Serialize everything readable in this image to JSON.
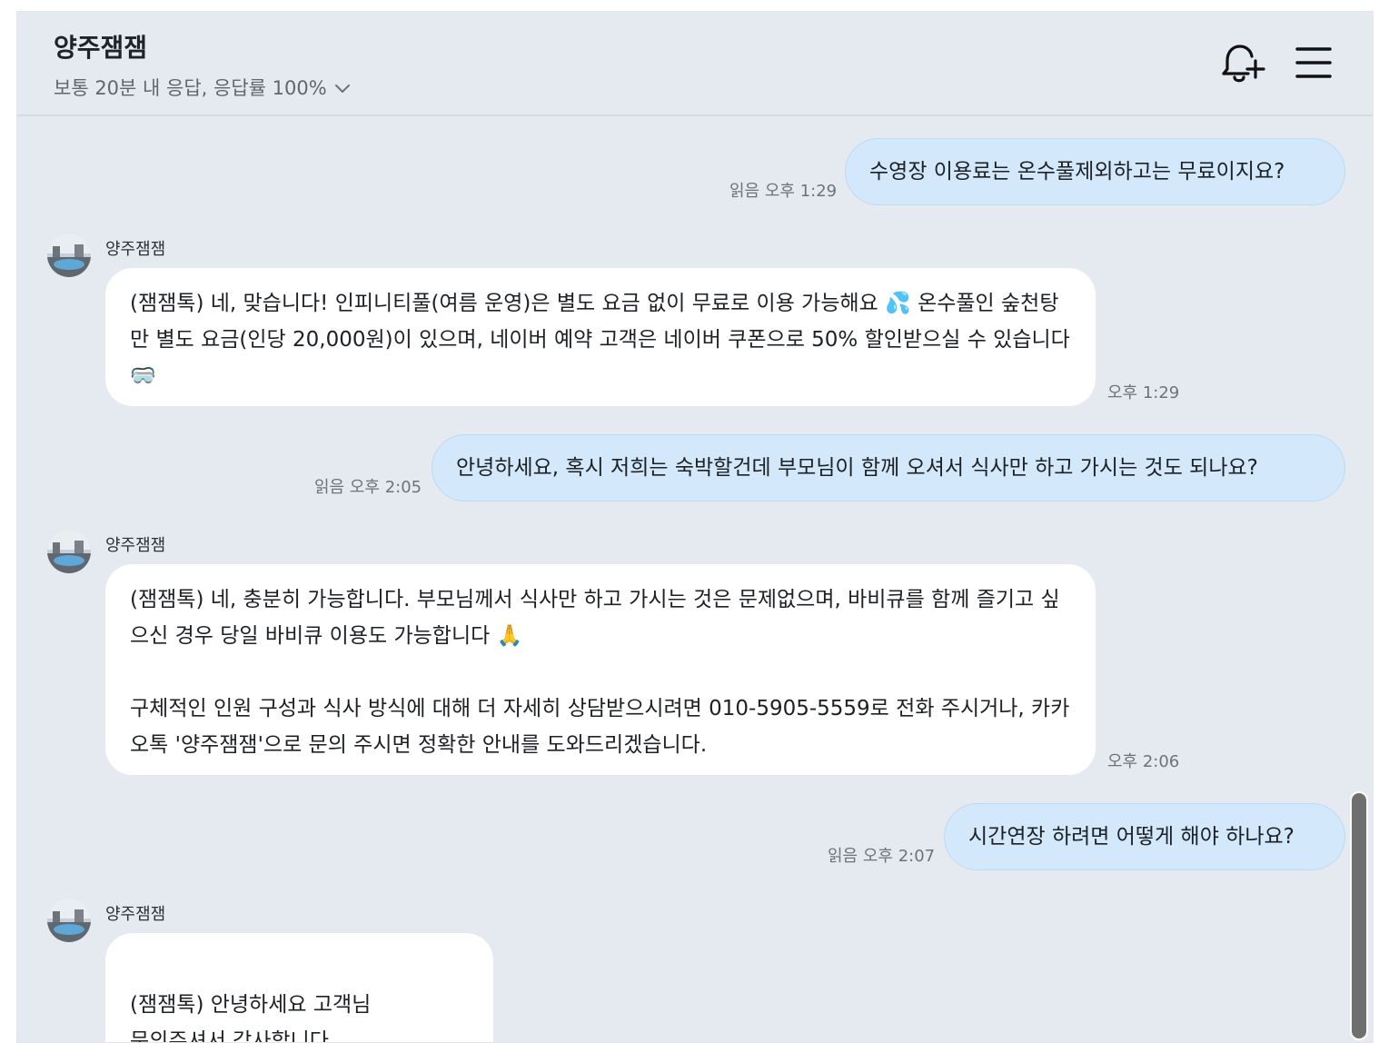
{
  "header": {
    "title": "양주잼잼",
    "subtitle": "보통 20분 내 응답, 응답률 100%",
    "icons": [
      "chevron-down-icon",
      "bell-plus-icon",
      "hamburger-menu-icon"
    ]
  },
  "bot": {
    "name": "양주잼잼"
  },
  "messages": [
    {
      "side": "user",
      "text": "수영장 이용료는 온수풀제외하고는 무료이지요?",
      "read": "읽음",
      "time": "오후 1:29"
    },
    {
      "side": "bot",
      "sender": "양주잼잼",
      "paragraphs": [
        "(잼잼톡) 네, 맞습니다! 인피니티풀(여름 운영)은 별도 요금 없이 무료로 이용 가능해요 💦 온수풀인 숲천탕만 별도 요금(인당 20,000원)이 있으며, 네이버 예약 고객은 네이버 쿠폰으로 50% 할인받으실 수 있습니다 🥽"
      ],
      "time": "오후 1:29"
    },
    {
      "side": "user",
      "text": "안녕하세요, 혹시 저희는 숙박할건데 부모님이 함께 오셔서 식사만 하고 가시는 것도 되나요?",
      "read": "읽음",
      "time": "오후 2:05"
    },
    {
      "side": "bot",
      "sender": "양주잼잼",
      "paragraphs": [
        "(잼잼톡) 네, 충분히 가능합니다. 부모님께서 식사만 하고 가시는 것은 문제없으며, 바비큐를 함께 즐기고 싶으신 경우 당일 바비큐 이용도 가능합니다 🙏",
        "구체적인 인원 구성과 식사 방식에 대해 더 자세히 상담받으시려면 010-5905-5559로 전화 주시거나, 카카오톡 '양주잼잼'으로 문의 주시면 정확한 안내를 도와드리겠습니다."
      ],
      "time": "오후 2:06"
    },
    {
      "side": "user",
      "text": "시간연장 하려면 어떻게 해야 하나요?",
      "read": "읽음",
      "time": "오후 2:07"
    },
    {
      "side": "bot",
      "sender": "양주잼잼",
      "paragraphs": [
        "(잼잼톡) 안녕하세요 고객님\n문의주셔서 감사합니다"
      ]
    }
  ],
  "colors": {
    "background": "#e5eaf1",
    "user_bubble": "#d3e9fb",
    "bot_bubble": "#ffffff",
    "scrollbar": "#6f6f6f"
  }
}
